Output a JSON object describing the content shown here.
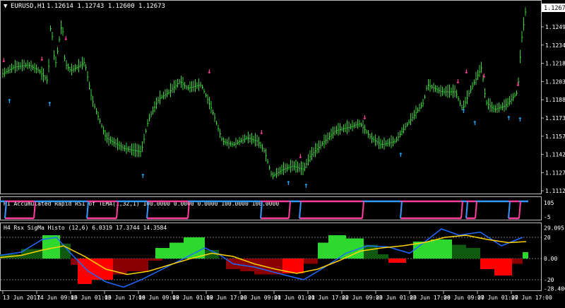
{
  "main_window": {
    "title": "EURUSD,H1",
    "ohlc": "1.12614 1.12743 1.12600 1.12673",
    "current_price": "1.12673",
    "price_axis": [
      "1.12494",
      "1.12344",
      "1.12189",
      "1.12039",
      "1.11884",
      "1.11734",
      "1.11579",
      "1.11429",
      "1.11279",
      "1.11124"
    ]
  },
  "rsi_window": {
    "title": "H1 Accumulated Rapid RSI of TEMA(1,32,1) 100.0000 0.0000 0.0000 100.0000 100.0000",
    "axis": [
      "105",
      "-5"
    ]
  },
  "histo_window": {
    "title": "H4  Rsx SigMa Histo (12,6) 6.0319 17.3744 14.3584",
    "axis": [
      "29.095",
      "20",
      "0.00",
      "-20",
      "-28.4004"
    ]
  },
  "time_axis": [
    "13 Jun 2017",
    "14 Jun 09:00",
    "15 Jun 01:00",
    "15 Jun 17:00",
    "16 Jun 09:00",
    "19 Jun 01:00",
    "19 Jun 17:00",
    "20 Jun 09:00",
    "21 Jun 01:00",
    "21 Jun 17:00",
    "22 Jun 09:00",
    "23 Jun 01:00",
    "23 Jun 17:00",
    "26 Jun 09:00",
    "27 Jun 01:00",
    "27 Jun 17:00"
  ],
  "colors": {
    "bars": "#3cd53c",
    "up_arrow": "#1fa9ff",
    "down_arrow": "#ff3d9a",
    "rsi_line_a": "#ff3d9a",
    "rsi_line_b": "#3399ff",
    "histo_up_bright": "#2fd82f",
    "histo_up_dark": "#0f5a0f",
    "histo_down_bright": "#ff0000",
    "histo_down_dark": "#8a0000",
    "histo_line_blue": "#1e6bff",
    "histo_line_yellow": "#ffd400"
  },
  "glyphs": {
    "up_arrow": "↑",
    "down_arrow": "↓",
    "triangle": "▼"
  }
}
